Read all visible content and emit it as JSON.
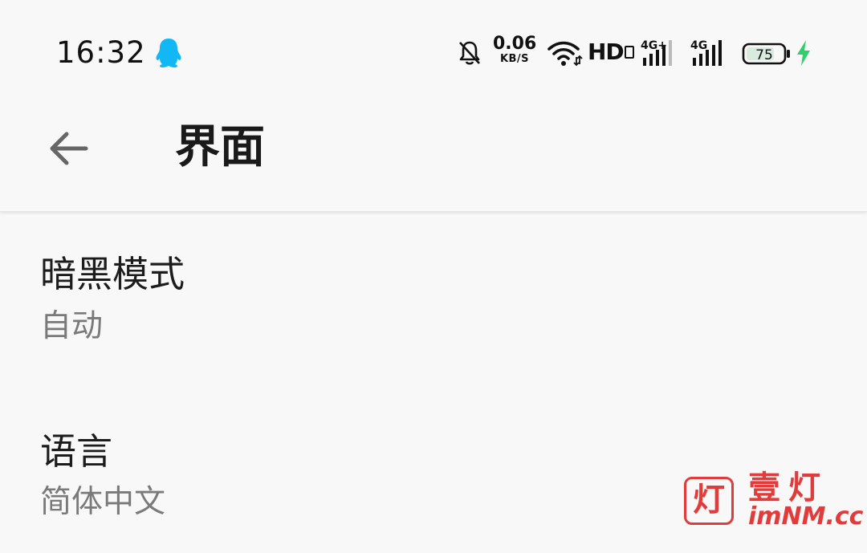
{
  "status_bar": {
    "time": "16:32",
    "net_speed_value": "0.06",
    "net_speed_unit": "KB/S",
    "hd_label": "HD",
    "signal1_label": "4G+",
    "signal2_label": "4G",
    "battery_level": "75",
    "icons": [
      "qq-icon",
      "mute-icon",
      "wifi-icon",
      "signal-icon",
      "battery-icon",
      "charging-icon"
    ],
    "charge_color": "#2fcf6b",
    "qq_color": "#12b7f5"
  },
  "app_bar": {
    "back_icon": "arrow-back-icon",
    "title": "界面"
  },
  "settings": [
    {
      "title": "暗黑模式",
      "summary": "自动"
    },
    {
      "title": "语言",
      "summary": "简体中文"
    }
  ],
  "watermark": {
    "logo_char": "灯",
    "brand": "壹灯",
    "domain": "imNM.cc",
    "color": "#e23b3b"
  }
}
